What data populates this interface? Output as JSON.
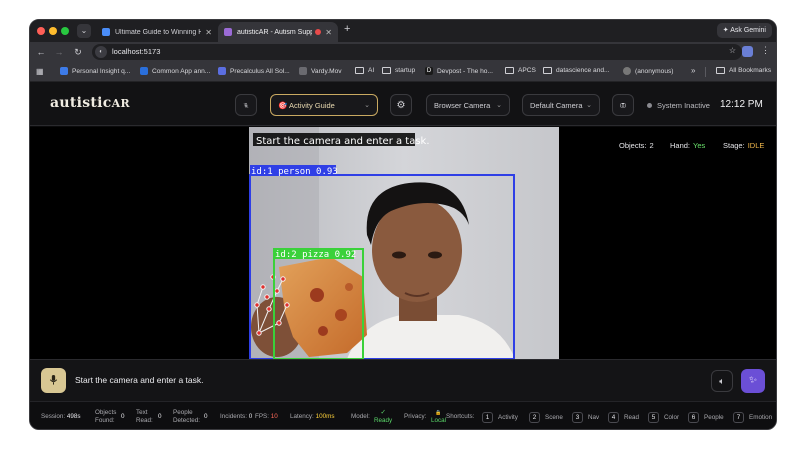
{
  "browser": {
    "tabs": [
      {
        "label": "Ultimate Guide to Winning Ha"
      },
      {
        "label": "autisticAR - Autism Supp"
      }
    ],
    "ask_gemini": "Ask Gemini",
    "url": "localhost:5173",
    "bookmarks": [
      "Personal Insight q...",
      "Common App ann...",
      "Precalculus All Sol...",
      "Vardy.Mov",
      "AI",
      "startup",
      "Devpost - The ho...",
      "APCS",
      "datascience and...",
      "(anonymous)"
    ],
    "more": "»",
    "all_bookmarks": "All Bookmarks"
  },
  "header": {
    "logo_main": "autistic",
    "logo_ar": "AR",
    "guide_label": "🎯 Activity Guide",
    "browser_camera": "Browser Camera",
    "default_camera": "Default Camera",
    "system_status": "System Inactive",
    "time": "12:12 PM"
  },
  "video": {
    "caption": "Start the camera and enter a task.",
    "det1": "id:1 person 0.93",
    "det2": "id:2 pizza 0.92",
    "box_person_color": "#2f3fe6",
    "box_pizza_color": "#3ad13a"
  },
  "stats": {
    "objects_label": "Objects:",
    "objects_value": "2",
    "hand_label": "Hand:",
    "hand_value": "Yes",
    "stage_label": "Stage:",
    "stage_value": "IDLE"
  },
  "input": {
    "prompt": "Start the camera and enter a task."
  },
  "footer": {
    "session_label": "Session:",
    "session_value": "498s",
    "objects_label1": "Objects",
    "objects_label2": "Found:",
    "objects_value": "0",
    "text_label1": "Text",
    "text_label2": "Read:",
    "text_value": "0",
    "people_label1": "People",
    "people_label2": "Detected:",
    "people_value": "0",
    "incidents_label": "Incidents:",
    "incidents_value": "0",
    "fps_label": "FPS:",
    "fps_value": "10",
    "latency_label": "Latency:",
    "latency_value": "100ms",
    "model_label": "Model:",
    "model_icon": "✓",
    "model_value": "Ready",
    "privacy_label": "Privacy:",
    "privacy_icon": "🔒",
    "privacy_value": "Local",
    "shortcuts_label": "Shortcuts:",
    "shortcuts": [
      {
        "key": "1",
        "label": "Activity"
      },
      {
        "key": "2",
        "label": "Scene"
      },
      {
        "key": "3",
        "label": "Nav"
      },
      {
        "key": "4",
        "label": "Read"
      },
      {
        "key": "5",
        "label": "Color"
      },
      {
        "key": "6",
        "label": "People"
      },
      {
        "key": "7",
        "label": "Emotion"
      }
    ]
  }
}
